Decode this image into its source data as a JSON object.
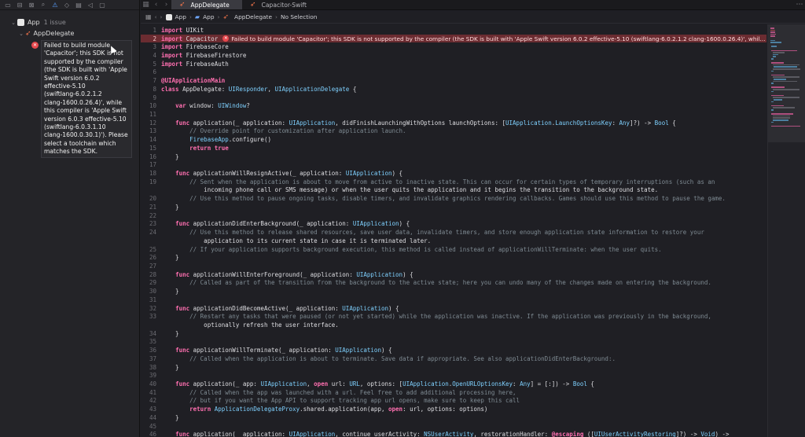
{
  "colors": {
    "error": "#e5484d",
    "error_line_bg": "#6b2c31",
    "keyword": "#ff6fb0",
    "type": "#7fd1ff",
    "comment": "#7e8a92",
    "accent": "#5aa0ff"
  },
  "navigator": {
    "toolbar_icons": [
      "folder-icon",
      "source-control-icon",
      "symbol-icon",
      "find-icon",
      "issue-icon",
      "test-icon",
      "debug-icon",
      "breakpoint-icon",
      "report-icon"
    ],
    "project": {
      "name": "App",
      "issue_count": "1 issue"
    },
    "file": {
      "name": "AppDelegate"
    },
    "issue": {
      "text": "Failed to build module\n'Capacitor'; this SDK is not\nsupported by the compiler\n(the SDK is built with 'Apple\nSwift version 6.0.2\neffective-5.10\n(swiftlang-6.0.2.1.2\nclang-1600.0.26.4)', while\nthis compiler is 'Apple Swift\nversion 6.0.3 effective-5.10\n(swiftlang-6.0.3.1.10\nclang-1600.0.30.1)'). Please\nselect a toolchain which\nmatches the SDK."
    }
  },
  "tabs": [
    {
      "label": "AppDelegate",
      "active": true
    },
    {
      "label": "Capacitor-Swift",
      "active": false
    }
  ],
  "breadcrumb": [
    "App",
    "App",
    "AppDelegate",
    "No Selection"
  ],
  "editor": {
    "inline_error": "Failed to build module 'Capacitor'; this SDK is not supported by the compiler (the SDK is built with 'Apple Swift version 6.0.2 effective-5.10 (swiftlang-6.0.2.1.2 clang-1600.0.26.4)', whil...",
    "lines": [
      {
        "n": "1",
        "code": "import UIKit"
      },
      {
        "n": "2",
        "code": "import Capacitor",
        "error": true
      },
      {
        "n": "3",
        "code": "import FirebaseCore"
      },
      {
        "n": "4",
        "code": "import FirebaseFirestore"
      },
      {
        "n": "5",
        "code": "import FirebaseAuth"
      },
      {
        "n": "6",
        "code": ""
      },
      {
        "n": "7",
        "code": "@UIApplicationMain"
      },
      {
        "n": "8",
        "code": "class AppDelegate: UIResponder, UIApplicationDelegate {"
      },
      {
        "n": "9",
        "code": ""
      },
      {
        "n": "10",
        "code": "    var window: UIWindow?"
      },
      {
        "n": "11",
        "code": ""
      },
      {
        "n": "12",
        "code": "    func application(_ application: UIApplication, didFinishLaunchingWithOptions launchOptions: [UIApplication.LaunchOptionsKey: Any]?) -> Bool {"
      },
      {
        "n": "13",
        "code": "        // Override point for customization after application launch."
      },
      {
        "n": "14",
        "code": "        FirebaseApp.configure()"
      },
      {
        "n": "15",
        "code": "        return true"
      },
      {
        "n": "16",
        "code": "    }"
      },
      {
        "n": "17",
        "code": ""
      },
      {
        "n": "18",
        "code": "    func applicationWillResignActive(_ application: UIApplication) {"
      },
      {
        "n": "19",
        "code": "        // Sent when the application is about to move from active to inactive state. This can occur for certain types of temporary interruptions (such as an"
      },
      {
        "n": "",
        "code": "            incoming phone call or SMS message) or when the user quits the application and it begins the transition to the background state."
      },
      {
        "n": "20",
        "code": "        // Use this method to pause ongoing tasks, disable timers, and invalidate graphics rendering callbacks. Games should use this method to pause the game."
      },
      {
        "n": "21",
        "code": "    }"
      },
      {
        "n": "22",
        "code": ""
      },
      {
        "n": "23",
        "code": "    func applicationDidEnterBackground(_ application: UIApplication) {"
      },
      {
        "n": "24",
        "code": "        // Use this method to release shared resources, save user data, invalidate timers, and store enough application state information to restore your"
      },
      {
        "n": "",
        "code": "            application to its current state in case it is terminated later."
      },
      {
        "n": "25",
        "code": "        // If your application supports background execution, this method is called instead of applicationWillTerminate: when the user quits."
      },
      {
        "n": "26",
        "code": "    }"
      },
      {
        "n": "27",
        "code": ""
      },
      {
        "n": "28",
        "code": "    func applicationWillEnterForeground(_ application: UIApplication) {"
      },
      {
        "n": "29",
        "code": "        // Called as part of the transition from the background to the active state; here you can undo many of the changes made on entering the background."
      },
      {
        "n": "30",
        "code": "    }"
      },
      {
        "n": "31",
        "code": ""
      },
      {
        "n": "32",
        "code": "    func applicationDidBecomeActive(_ application: UIApplication) {"
      },
      {
        "n": "33",
        "code": "        // Restart any tasks that were paused (or not yet started) while the application was inactive. If the application was previously in the background,"
      },
      {
        "n": "",
        "code": "            optionally refresh the user interface."
      },
      {
        "n": "34",
        "code": "    }"
      },
      {
        "n": "35",
        "code": ""
      },
      {
        "n": "36",
        "code": "    func applicationWillTerminate(_ application: UIApplication) {"
      },
      {
        "n": "37",
        "code": "        // Called when the application is about to terminate. Save data if appropriate. See also applicationDidEnterBackground:."
      },
      {
        "n": "38",
        "code": "    }"
      },
      {
        "n": "39",
        "code": ""
      },
      {
        "n": "40",
        "code": "    func application(_ app: UIApplication, open url: URL, options: [UIApplication.OpenURLOptionsKey: Any] = [:]) -> Bool {"
      },
      {
        "n": "41",
        "code": "        // Called when the app was launched with a url. Feel free to add additional processing here,"
      },
      {
        "n": "42",
        "code": "        // but if you want the App API to support tracking app url opens, make sure to keep this call"
      },
      {
        "n": "43",
        "code": "        return ApplicationDelegateProxy.shared.application(app, open: url, options: options)"
      },
      {
        "n": "44",
        "code": "    }"
      },
      {
        "n": "45",
        "code": ""
      },
      {
        "n": "46",
        "code": "    func application(_ application: UIApplication, continue userActivity: NSUserActivity, restorationHandler: @escaping ([UIUserActivityRestoring]?) -> Void) ->"
      }
    ]
  }
}
